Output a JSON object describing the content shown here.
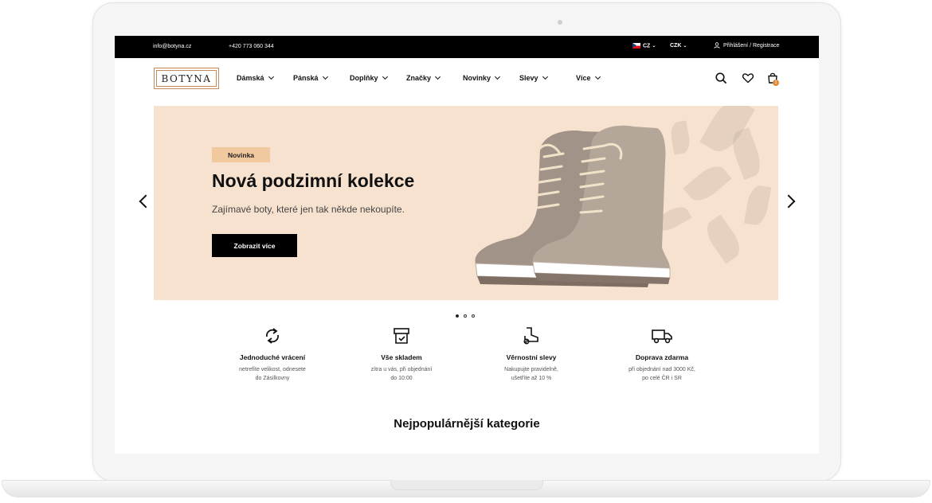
{
  "topbar": {
    "email": "info@botyna.cz",
    "phone": "+420 773 060 344",
    "language": "CZ",
    "currency": "CZK",
    "login": "Přihlášení / Registrace"
  },
  "logo": {
    "text": "BOTYNA"
  },
  "nav": {
    "items": [
      {
        "label": "Dámská"
      },
      {
        "label": "Pánská"
      },
      {
        "label": "Doplňky"
      },
      {
        "label": "Značky"
      },
      {
        "label": "Novinky"
      },
      {
        "label": "Slevy"
      },
      {
        "label": "Více"
      }
    ]
  },
  "cart": {
    "count": "1"
  },
  "hero": {
    "tag": "Novinka",
    "title": "Nová podzimní kolekce",
    "subtitle": "Zajímavé boty, které jen tak někde nekoupíte.",
    "button": "Zobrazit více"
  },
  "slider": {
    "slides": 3,
    "active": 1
  },
  "features": [
    {
      "title": "Jednoduché vrácení",
      "line1": "netrefíte velikost, odnesete",
      "line2": "do Zásilkovny"
    },
    {
      "title": "Vše skladem",
      "line1": "zítra u vás, při objednání",
      "line2": "do 10:00"
    },
    {
      "title": "Věrnostní slevy",
      "line1": "Nakupujte pravidelně,",
      "line2": "ušetříte až 10 %"
    },
    {
      "title": "Doprava zdarma",
      "line1": "při objednání nad 3000 Kč,",
      "line2": "po celé ČR i SR"
    }
  ],
  "section": {
    "title": "Nejpopulárnější kategorie"
  },
  "colors": {
    "accent": "#f2c99f",
    "hero_bg": "#f7e2cf",
    "logo_border": "#c48a5a",
    "badge": "#e08a3c"
  }
}
